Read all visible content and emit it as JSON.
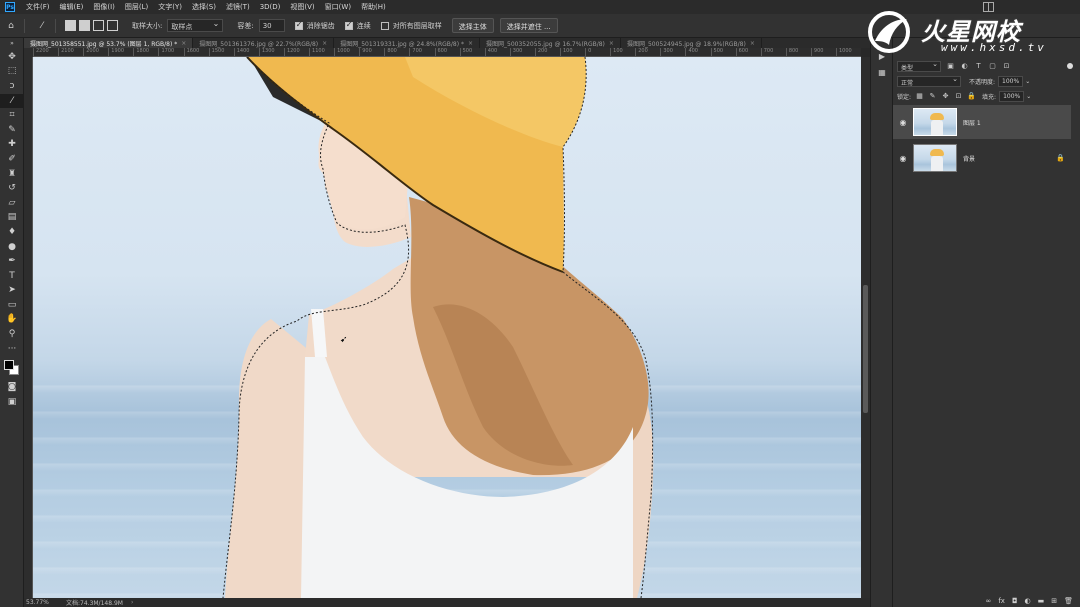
{
  "app": {
    "logo": "Ps"
  },
  "menu": [
    "文件(F)",
    "编辑(E)",
    "图像(I)",
    "图层(L)",
    "文字(Y)",
    "选择(S)",
    "滤镜(T)",
    "3D(D)",
    "视图(V)",
    "窗口(W)",
    "帮助(H)"
  ],
  "options": {
    "sample_size_label": "取样大小:",
    "sample_size_value": "取样点",
    "tolerance_label": "容差:",
    "tolerance_value": "30",
    "antialias_label": "消除锯齿",
    "antialias_checked": true,
    "contiguous_label": "连续",
    "contiguous_checked": true,
    "sample_all_label": "对所有图层取样",
    "sample_all_checked": false,
    "select_subject_label": "选择主体",
    "select_mask_label": "选择并遮住 ..."
  },
  "tabs": [
    "摄图网_501358551.jpg @ 53.7% (图层 1, RGB/8) *",
    "摄图网_501361376.jpg @ 22.7%(RGB/8)",
    "摄图网_501319331.jpg @ 24.8%(RGB/8) *",
    "摄图网_500352055.jpg @ 16.7%(RGB/8)",
    "摄图网_500524945.jpg @ 18.9%(RGB/8)"
  ],
  "ruler_top": [
    "2200",
    "2100",
    "2000",
    "1900",
    "1800",
    "1700",
    "1600",
    "1500",
    "1400",
    "1300",
    "1200",
    "1100",
    "1000",
    "900",
    "800",
    "700",
    "600",
    "500",
    "400",
    "300",
    "200",
    "100",
    "0",
    "100",
    "200",
    "300",
    "400",
    "500",
    "600",
    "700",
    "800",
    "900",
    "1000"
  ],
  "status": {
    "zoom": "53.77%",
    "doc": "文档:74.3M/148.9M"
  },
  "layers_panel": {
    "filter_kind": "类型",
    "blend_mode": "正常",
    "opacity_label": "不透明度:",
    "opacity_value": "100%",
    "lock_label": "锁定:",
    "fill_label": "填充:",
    "fill_value": "100%",
    "layers": [
      {
        "name": "图层 1",
        "selected": true,
        "locked": false
      },
      {
        "name": "背景",
        "selected": false,
        "locked": true
      }
    ]
  },
  "watermark": {
    "title": "火星网校",
    "url": "www.hxsd.tv"
  },
  "colors": {
    "accent": "#31a8ff",
    "foreground": "#000000",
    "background": "#ffffff",
    "hat": "#f0b94f"
  }
}
